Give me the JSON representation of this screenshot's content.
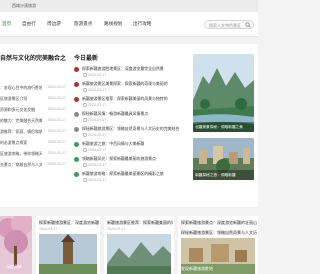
{
  "site": {
    "name": "西域沙漠旅游",
    "colors": {
      "accent": "#2a8f4e",
      "nav_bg": "#ffffff",
      "page_bg": "#f3f3f3"
    }
  },
  "nav": {
    "items": [
      {
        "label": "首页",
        "active": true
      },
      {
        "label": "自由行"
      },
      {
        "label": "周边游"
      },
      {
        "label": "旅游景点"
      },
      {
        "label": "路线规划"
      },
      {
        "label": "出行攻略"
      }
    ],
    "search_placeholder": "搜索人文特色景区",
    "search_icon": "search-icon"
  },
  "left": {
    "title": "自然与文化的完美融合之旅",
    "items": [
      {
        "title": "：发现心目中的旅行胜地",
        "date": "2024-03-17"
      },
      {
        "title": "区旅游景区介绍",
        "date": "2024-03-17"
      },
      {
        "title": "资源和多元文化交融",
        "date": "2024-03-17"
      },
      {
        "title": "的魅力：完美融合天然美景",
        "date": "2024-03-17"
      },
      {
        "title": "游推荐：家庭、情侣和朋友",
        "date": "2024-03-17"
      },
      {
        "title": "的必游景点探索",
        "date": "2024-03-17"
      },
      {
        "title": "区旅游攻略，带你领略天然",
        "date": "2024-03-17"
      },
      {
        "title": "光景点：穿越自然与人文",
        "date": "2024-03-17"
      }
    ]
  },
  "middle": {
    "title": "今日最新",
    "items": [
      {
        "title": "探索新疆旅游胜地景区：深度游览最完全自然景",
        "date": "2024-03-17",
        "dot": "red"
      },
      {
        "title": "新疆旅游景区美景探索：探索新疆的奇观与美丽的",
        "date": "2024-03-17",
        "dot": "red"
      },
      {
        "title": "新疆旅游景区推荐：探索新疆美丽的风景与独特的",
        "date": "2024-03-17",
        "dot": "red"
      },
      {
        "title": "探秘新疆风情：畅游新疆最具风情景点",
        "date": "2024-03-17",
        "dot": "gray"
      },
      {
        "title": "探秘新疆旅游景区：领略自然奇景与人文历史的完美结合",
        "date": "2024-03-17",
        "dot": "gray"
      },
      {
        "title": "新疆旅游之旅：中西风情与大美新疆",
        "date": "2024-03-17",
        "dot": "green"
      },
      {
        "title": "领略新疆风光：探索新疆最美丽的旅游景点",
        "date": "2024-03-17",
        "dot": "green"
      },
      {
        "title": "新疆旅游攻略：探索新疆最美丽景区的精彩之旅",
        "date": "2024-03-17",
        "dot": "green"
      }
    ]
  },
  "right": {
    "images": [
      {
        "caption": "北疆美景探秘：领略新疆之美"
      },
      {
        "caption": "南疆探秘之旅：领略新疆"
      }
    ]
  },
  "cards": [
    {
      "title": "：深度游新"
    },
    {
      "title": "探索新疆旅游景区：深度游览新疆的山水与人文",
      "date": "2024-03-17"
    },
    {
      "title": "新疆旅游景区推荐：探索新疆美丽的风景与独特的",
      "date": "2024-03-17"
    },
    {
      "title": "探索新疆旅游景点：深度游览新疆的壮丽山水"
    },
    {
      "title": "探秘新疆旅游景区：领略自然奇景与人文历史"
    },
    {
      "title": "发现新疆旅游胜地"
    }
  ]
}
